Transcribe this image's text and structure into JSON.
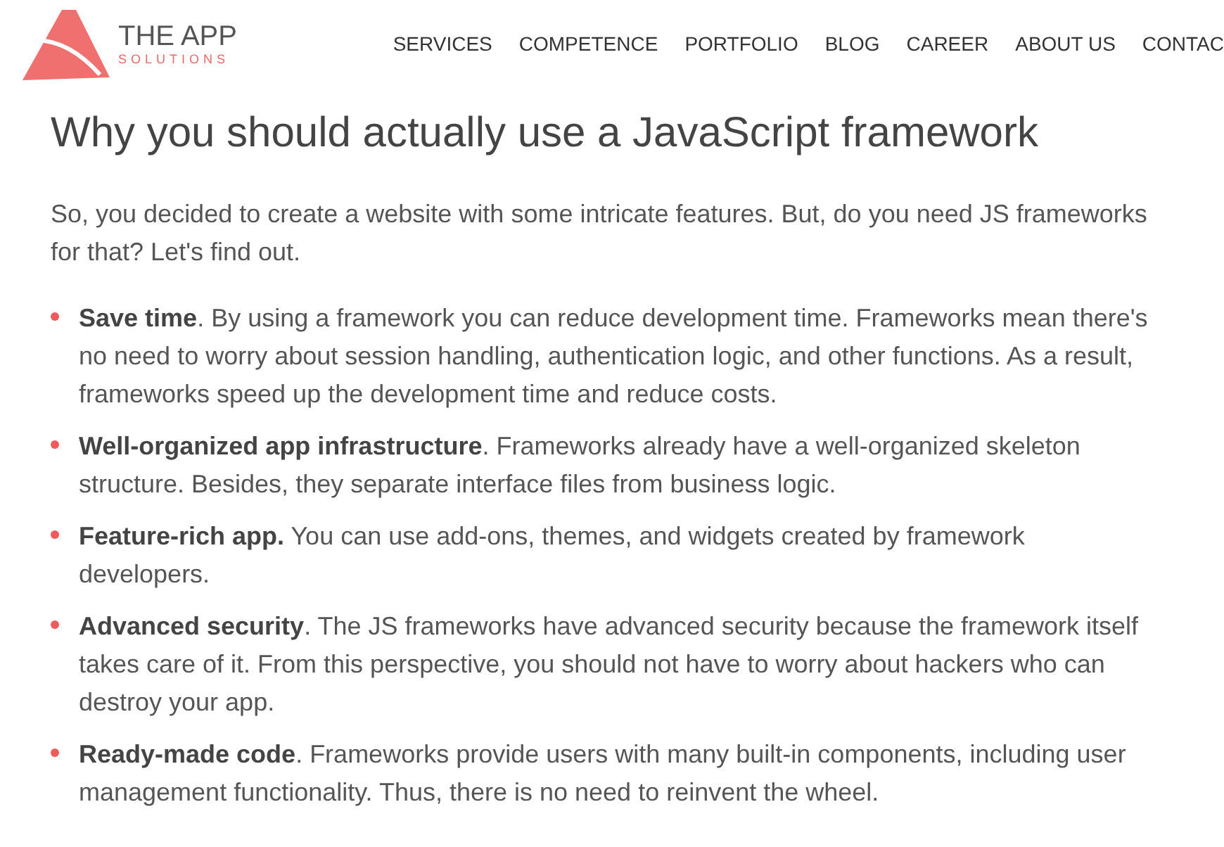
{
  "logo": {
    "title": "THE APP",
    "subtitle": "SOLUTIONS"
  },
  "nav": [
    "SERVICES",
    "COMPETENCE",
    "PORTFOLIO",
    "BLOG",
    "CAREER",
    "ABOUT US",
    "CONTAC"
  ],
  "article": {
    "heading": "Why you should actually use a JavaScript framework",
    "intro": "So, you decided to create a website with some intricate features. But, do you need JS frameworks for that? Let's find out.",
    "bullets": [
      "**Save time**. By using a framework you can reduce development time.  Frameworks mean there's no need to worry about session handling, authentication logic, and other functions. As a result, frameworks speed up the development time and reduce costs.",
      "**Well-organized app infrastructure**. Frameworks already have a well-organized skeleton structure. Besides, they separate interface files from business logic.",
      "**Feature-rich app.** You can use add-ons, themes, and widgets created by framework developers.",
      "**Advanced security**. The JS frameworks have advanced security because the framework itself takes care of it. From this perspective, you should not have to worry about hackers who can destroy your app.",
      "**Ready-made code**. Frameworks provide users with many built-in components, including user management functionality. Thus, there is no need to reinvent the wheel."
    ]
  }
}
